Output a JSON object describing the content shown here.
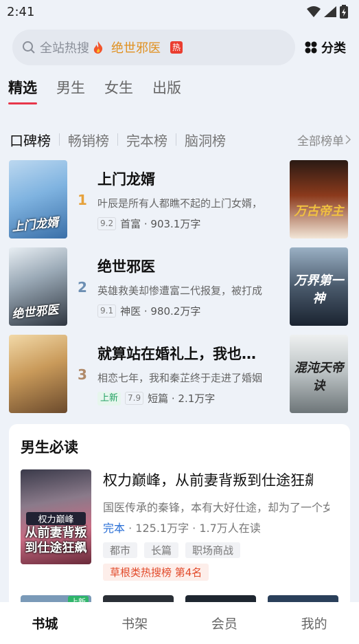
{
  "status_bar": {
    "time": "2:41"
  },
  "search": {
    "placeholder": "全站热搜",
    "keyword": "绝世邪医",
    "badge": "热"
  },
  "header": {
    "category_label": "分类"
  },
  "tabs": [
    {
      "label": "精选",
      "active": true
    },
    {
      "label": "男生"
    },
    {
      "label": "女生"
    },
    {
      "label": "出版"
    }
  ],
  "rank_tabs": [
    {
      "label": "口碑榜",
      "active": true
    },
    {
      "label": "畅销榜"
    },
    {
      "label": "完本榜"
    },
    {
      "label": "脑洞榜"
    }
  ],
  "all_lists_label": "全部榜单",
  "rank_items": [
    {
      "rank": "1",
      "title": "上门龙婿",
      "cover_text": "上门龙婿",
      "desc": "叶辰是所有人都瞧不起的上门女婿，但谁又能想到",
      "score": "9.2",
      "meta": "首富 · 903.1万字",
      "side_cover_text": "万古帝主"
    },
    {
      "rank": "2",
      "title": "绝世邪医",
      "cover_text": "绝世邪医",
      "desc": "英雄救美却惨遭富二代报复，被打成废人的陈凡",
      "score": "9.1",
      "meta": "神医 · 980.2万字",
      "side_cover_text": "万界第一神"
    },
    {
      "rank": "3",
      "title": "就算站在婚礼上，我也要跟你分手",
      "cover_text": "",
      "desc": "相恋七年，我和秦芷终于走进了婚姻的殿堂",
      "new_label": "上新",
      "score": "7.9",
      "meta": "短篇 · 2.1万字",
      "side_cover_text": "混沌天帝诀"
    }
  ],
  "section": {
    "title": "男生必读",
    "book": {
      "title": "权力巅峰，从前妻背叛到仕途狂飙",
      "cover_line1": "权力巅峰",
      "cover_line2": "从前妻背叛到仕途狂飙",
      "desc": "国医传承的秦锋，本有大好仕途，却为了一个女人",
      "status": "完本",
      "stats": "· 125.1万字 · 1.7万人在读",
      "tags": [
        "都市",
        "长篇",
        "职场商战"
      ],
      "ranking": "草根类热搜榜 第4名"
    },
    "peek_badge": "上新"
  },
  "bottom_nav": [
    {
      "label": "书城",
      "active": true
    },
    {
      "label": "书架"
    },
    {
      "label": "会员"
    },
    {
      "label": "我的"
    }
  ]
}
